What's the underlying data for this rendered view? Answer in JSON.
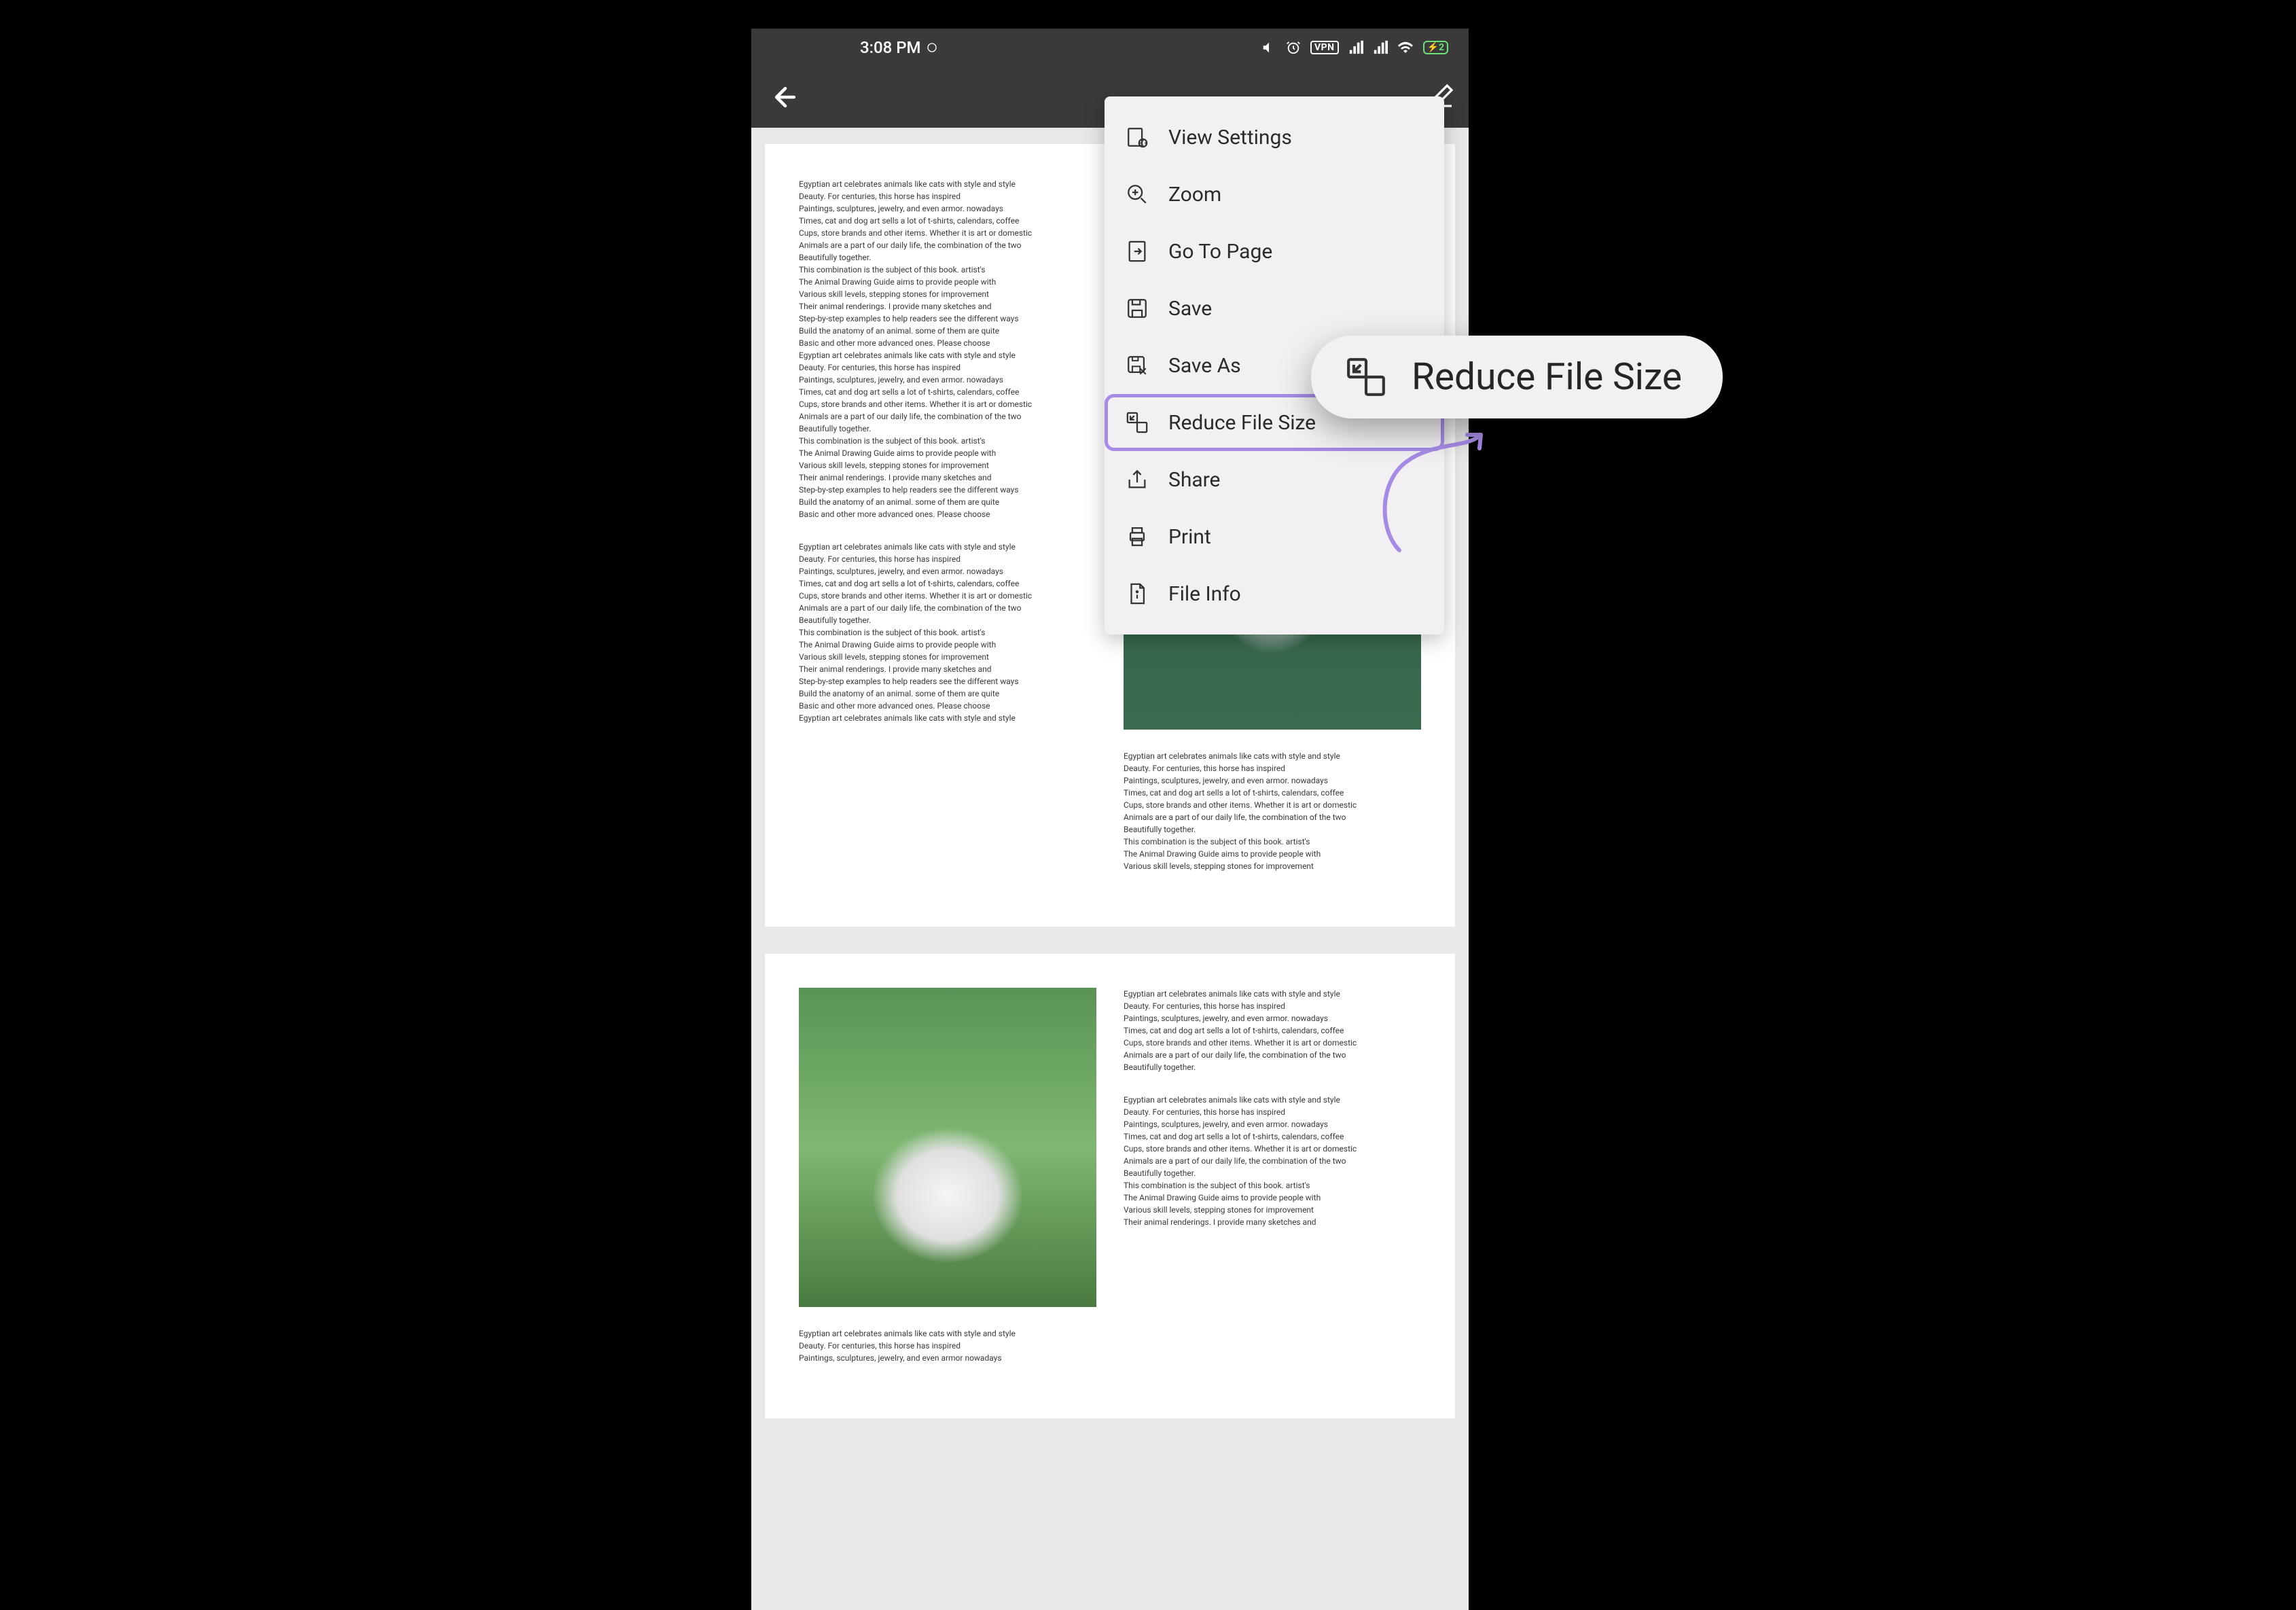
{
  "status": {
    "time": "3:08 PM",
    "vpn": "VPN",
    "battery_level": "2"
  },
  "menu": {
    "items": [
      {
        "label": "View Settings",
        "icon": "view-settings-icon"
      },
      {
        "label": "Zoom",
        "icon": "zoom-icon"
      },
      {
        "label": "Go To Page",
        "icon": "goto-page-icon"
      },
      {
        "label": "Save",
        "icon": "save-icon"
      },
      {
        "label": "Save As",
        "icon": "save-as-icon"
      },
      {
        "label": "Reduce File Size",
        "icon": "reduce-file-icon",
        "highlighted": true
      },
      {
        "label": "Share",
        "icon": "share-icon"
      },
      {
        "label": "Print",
        "icon": "print-icon"
      },
      {
        "label": "File Info",
        "icon": "file-info-icon"
      }
    ]
  },
  "callout": {
    "label": "Reduce File Size"
  },
  "doc": {
    "p1c1a": "Egyptian art celebrates animals like cats with style and style\nDeauty. For centuries, this horse has inspired\nPaintings, sculptures, jewelry, and even armor. nowadays\nTimes, cat and dog art sells a lot of t-shirts, calendars, coffee\nCups, store brands and other items. Whether it is art or domestic\nAnimals are a part of our daily life, the combination of the two\nBeautifully together.\nThis combination is the subject of this book. artist's\nThe Animal Drawing Guide aims to provide people with\nVarious skill levels, stepping stones for improvement\nTheir animal renderings. I provide many sketches and\nStep-by-step examples to help readers see the different ways\nBuild the anatomy of an animal. some of them are quite\nBasic and other more advanced ones. Please choose\nEgyptian art celebrates animals like cats with style and style\nDeauty. For centuries, this horse has inspired\nPaintings, sculptures, jewelry, and even armor. nowadays\nTimes, cat and dog art sells a lot of t-shirts, calendars, coffee\nCups, store brands and other items. Whether it is art or domestic\nAnimals are a part of our daily life, the combination of the two\nBeautifully together.\nThis combination is the subject of this book. artist's\nThe Animal Drawing Guide aims to provide people with\nVarious skill levels, stepping stones for improvement\nTheir animal renderings. I provide many sketches and\nStep-by-step examples to help readers see the different ways\nBuild the anatomy of an animal. some of them are quite\nBasic and other more advanced ones. Please choose",
    "p1c1b": "Egyptian art celebrates animals like cats with style and style\nDeauty. For centuries, this horse has inspired\nPaintings, sculptures, jewelry, and even armor. nowadays\nTimes, cat and dog art sells a lot of t-shirts, calendars, coffee\nCups, store brands and other items. Whether it is art or domestic\nAnimals are a part of our daily life, the combination of the two\nBeautifully together.\nThis combination is the subject of this book. artist's\nThe Animal Drawing Guide aims to provide people with\nVarious skill levels, stepping stones for improvement\nTheir animal renderings. I provide many sketches and\nStep-by-step examples to help readers see the different ways\nBuild the anatomy of an animal. some of them are quite\nBasic and other more advanced ones. Please choose\nEgyptian art celebrates animals like cats with style and style",
    "p1c2a": "Egyptian art celebrates animals like cats with style and style\nDeauty. For centuries, this horse has inspired\nPaintings, sculptures, jewelry, and even armor. nowadays\nTimes, cat and dog art sells a lot of t-shirts, calendars, coffee\nCups, store brands and other items. Whether it is art or domestic\nAnimals are a part of our daily life, the combination of the two\nBeautifully together.\nThis combination is the subject of this book. artist's\nThe Animal Drawing Guide aims to provide people with\nVarious skill levels, stepping stones for improvement",
    "p2c1a": "Egyptian art celebrates animals like cats with style and style\nDeauty. For centuries, this horse has inspired\nPaintings, sculptures, jewelry, and even armor nowadays",
    "p2c2a": "Egyptian art celebrates animals like cats with style and style\nDeauty. For centuries, this horse has inspired\nPaintings, sculptures, jewelry, and even armor. nowadays\nTimes, cat and dog art sells a lot of t-shirts, calendars, coffee\nCups, store brands and other items. Whether it is art or domestic\nAnimals are a part of our daily life, the combination of the two\nBeautifully together.",
    "p2c2b": "Egyptian art celebrates animals like cats with style and style\nDeauty. For centuries, this horse has inspired\nPaintings, sculptures, jewelry, and even armor. nowadays\nTimes, cat and dog art sells a lot of t-shirts, calendars, coffee\nCups, store brands and other items. Whether it is art or domestic\nAnimals are a part of our daily life, the combination of the two\nBeautifully together.\nThis combination is the subject of this book. artist's\nThe Animal Drawing Guide aims to provide people with\nVarious skill levels, stepping stones for improvement\nTheir animal renderings. I provide many sketches and"
  }
}
